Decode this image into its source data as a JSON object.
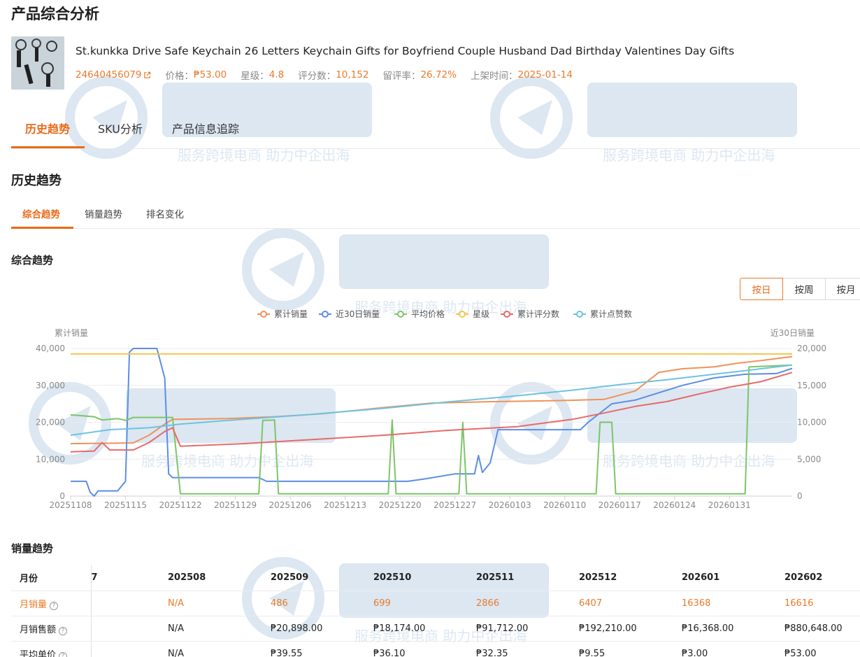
{
  "page": {
    "title": "产品综合分析"
  },
  "product": {
    "name": "St.kunkka Drive Safe Keychain 26 Letters Keychain Gifts for Boyfriend Couple Husband Dad Birthday Valentines Day Gifts",
    "id": "24640456079",
    "price_label": "价格：",
    "price": "₱53.00",
    "rating_label": "星级：",
    "rating": "4.8",
    "reviews_label": "评分数：",
    "reviews": "10,152",
    "retention_label": "留评率：",
    "retention": "26.72%",
    "listed_label": "上架时间：",
    "listed": "2025-01-14"
  },
  "main_tabs": [
    "历史趋势",
    "SKU分析",
    "产品信息追踪"
  ],
  "section_title": "历史趋势",
  "sub_tabs": [
    "综合趋势",
    "销量趋势",
    "排名变化"
  ],
  "chart_heading": "综合趋势",
  "granularity": {
    "options": [
      "按日",
      "按周",
      "按月"
    ],
    "selected": "按日"
  },
  "watermark": {
    "text": "服务跨境电商 助力中企出海"
  },
  "chart_data": {
    "type": "line",
    "ylabel_left": "累计销量",
    "ylabel_right": "近30日销量",
    "ylim_left": [
      0,
      40000
    ],
    "ylim_right": [
      0,
      20000
    ],
    "yticks_left": [
      "0",
      "10,000",
      "20,000",
      "30,000",
      "40,000"
    ],
    "yticks_right": [
      "0",
      "5,000",
      "10,000",
      "15,000",
      "20,000"
    ],
    "legend_position": "top",
    "x_ticks": [
      "20251108",
      "20251115",
      "20251122",
      "20251129",
      "20251206",
      "20251213",
      "20251220",
      "20251227",
      "20260103",
      "20260110",
      "20260117",
      "20260124",
      "20260131"
    ],
    "x_day_range": [
      0,
      92
    ],
    "series": [
      {
        "name": "累计销量",
        "color": "#f0925a",
        "axis": "left",
        "points": [
          [
            0,
            14200
          ],
          [
            4,
            14300
          ],
          [
            8,
            14400
          ],
          [
            10,
            16500
          ],
          [
            12,
            19500
          ],
          [
            13,
            20800
          ],
          [
            20,
            21000
          ],
          [
            26,
            21500
          ],
          [
            32,
            22300
          ],
          [
            40,
            24000
          ],
          [
            46,
            25200
          ],
          [
            54,
            25600
          ],
          [
            63,
            25900
          ],
          [
            68,
            26200
          ],
          [
            72,
            28500
          ],
          [
            75,
            33500
          ],
          [
            78,
            34500
          ],
          [
            82,
            35000
          ],
          [
            85,
            36000
          ],
          [
            88,
            36700
          ],
          [
            92,
            37800
          ]
        ]
      },
      {
        "name": "近30日销量",
        "color": "#5b8ee6",
        "axis": "right",
        "points": [
          [
            0,
            2000
          ],
          [
            2,
            2000
          ],
          [
            2.5,
            500
          ],
          [
            3,
            0
          ],
          [
            3.5,
            700
          ],
          [
            6,
            700
          ],
          [
            7,
            2000
          ],
          [
            7.5,
            19500
          ],
          [
            8,
            20000
          ],
          [
            11,
            20000
          ],
          [
            12,
            16000
          ],
          [
            12.5,
            3000
          ],
          [
            13,
            2500
          ],
          [
            24,
            2500
          ],
          [
            25,
            2000
          ],
          [
            43,
            2000
          ],
          [
            45,
            2300
          ],
          [
            49,
            3000
          ],
          [
            51.5,
            3000
          ],
          [
            52,
            5500
          ],
          [
            52.5,
            3200
          ],
          [
            53.5,
            4500
          ],
          [
            54.5,
            9000
          ],
          [
            65,
            9000
          ],
          [
            66,
            10000
          ],
          [
            69,
            12500
          ],
          [
            72,
            13000
          ],
          [
            75,
            14000
          ],
          [
            78,
            15000
          ],
          [
            82,
            16000
          ],
          [
            86,
            16500
          ],
          [
            90,
            16600
          ],
          [
            92,
            17300
          ]
        ]
      },
      {
        "name": "平均价格",
        "color": "#7cc568",
        "axis": "left",
        "points": [
          [
            0,
            22000
          ],
          [
            3,
            21500
          ],
          [
            4,
            20600
          ],
          [
            6,
            21000
          ],
          [
            7,
            20500
          ],
          [
            8,
            21300
          ],
          [
            13,
            21300
          ],
          [
            14,
            600
          ],
          [
            24,
            600
          ],
          [
            24.5,
            20500
          ],
          [
            26,
            20600
          ],
          [
            26.5,
            600
          ],
          [
            40.5,
            600
          ],
          [
            41,
            20600
          ],
          [
            41.5,
            600
          ],
          [
            49.5,
            600
          ],
          [
            50,
            20000
          ],
          [
            50.5,
            600
          ],
          [
            67,
            600
          ],
          [
            67.5,
            20000
          ],
          [
            69,
            20000
          ],
          [
            69.5,
            600
          ],
          [
            86,
            600
          ],
          [
            86.5,
            35000
          ],
          [
            92,
            35500
          ]
        ]
      },
      {
        "name": "星级",
        "color": "#f4c54e",
        "axis": "left",
        "points": [
          [
            0,
            38500
          ],
          [
            92,
            38500
          ]
        ]
      },
      {
        "name": "累计评分数",
        "color": "#e86a6a",
        "axis": "left",
        "points": [
          [
            0,
            12000
          ],
          [
            3,
            12200
          ],
          [
            4,
            14500
          ],
          [
            5,
            12500
          ],
          [
            8,
            12500
          ],
          [
            10,
            14500
          ],
          [
            12,
            17500
          ],
          [
            13,
            18500
          ],
          [
            14,
            13500
          ],
          [
            22,
            14200
          ],
          [
            30,
            15200
          ],
          [
            40,
            16500
          ],
          [
            48,
            17800
          ],
          [
            57,
            18800
          ],
          [
            60,
            19700
          ],
          [
            64,
            20800
          ],
          [
            68,
            22500
          ],
          [
            72,
            24300
          ],
          [
            76,
            25600
          ],
          [
            80,
            27600
          ],
          [
            84,
            29500
          ],
          [
            88,
            31000
          ],
          [
            92,
            33500
          ]
        ]
      },
      {
        "name": "累计点赞数",
        "color": "#6fc2e0",
        "axis": "left",
        "points": [
          [
            0,
            16500
          ],
          [
            5,
            18000
          ],
          [
            10,
            18500
          ],
          [
            14,
            19500
          ],
          [
            22,
            20800
          ],
          [
            30,
            22000
          ],
          [
            40,
            23800
          ],
          [
            48,
            25500
          ],
          [
            56,
            27000
          ],
          [
            64,
            28700
          ],
          [
            70,
            30200
          ],
          [
            76,
            31500
          ],
          [
            82,
            33000
          ],
          [
            86,
            34000
          ],
          [
            90,
            35000
          ],
          [
            92,
            35500
          ]
        ]
      }
    ]
  },
  "table": {
    "heading": "销量趋势",
    "columns": [
      "月份",
      "7",
      "202508",
      "202509",
      "202510",
      "202511",
      "202512",
      "202601",
      "202602"
    ],
    "rows": [
      {
        "label": "月销量",
        "values": [
          "",
          "N/A",
          "486",
          "699",
          "2866",
          "6407",
          "16368",
          "16616"
        ]
      },
      {
        "label": "月销售额",
        "values": [
          "",
          "N/A",
          "₱20,898.00",
          "₱18,174.00",
          "₱91,712.00",
          "₱192,210.00",
          "₱16,368.00",
          "₱880,648.00"
        ]
      },
      {
        "label": "平均单价",
        "values": [
          "",
          "N/A",
          "₱39.55",
          "₱36.10",
          "₱32.35",
          "₱9.55",
          "₱3.00",
          "₱53.00"
        ]
      }
    ]
  }
}
